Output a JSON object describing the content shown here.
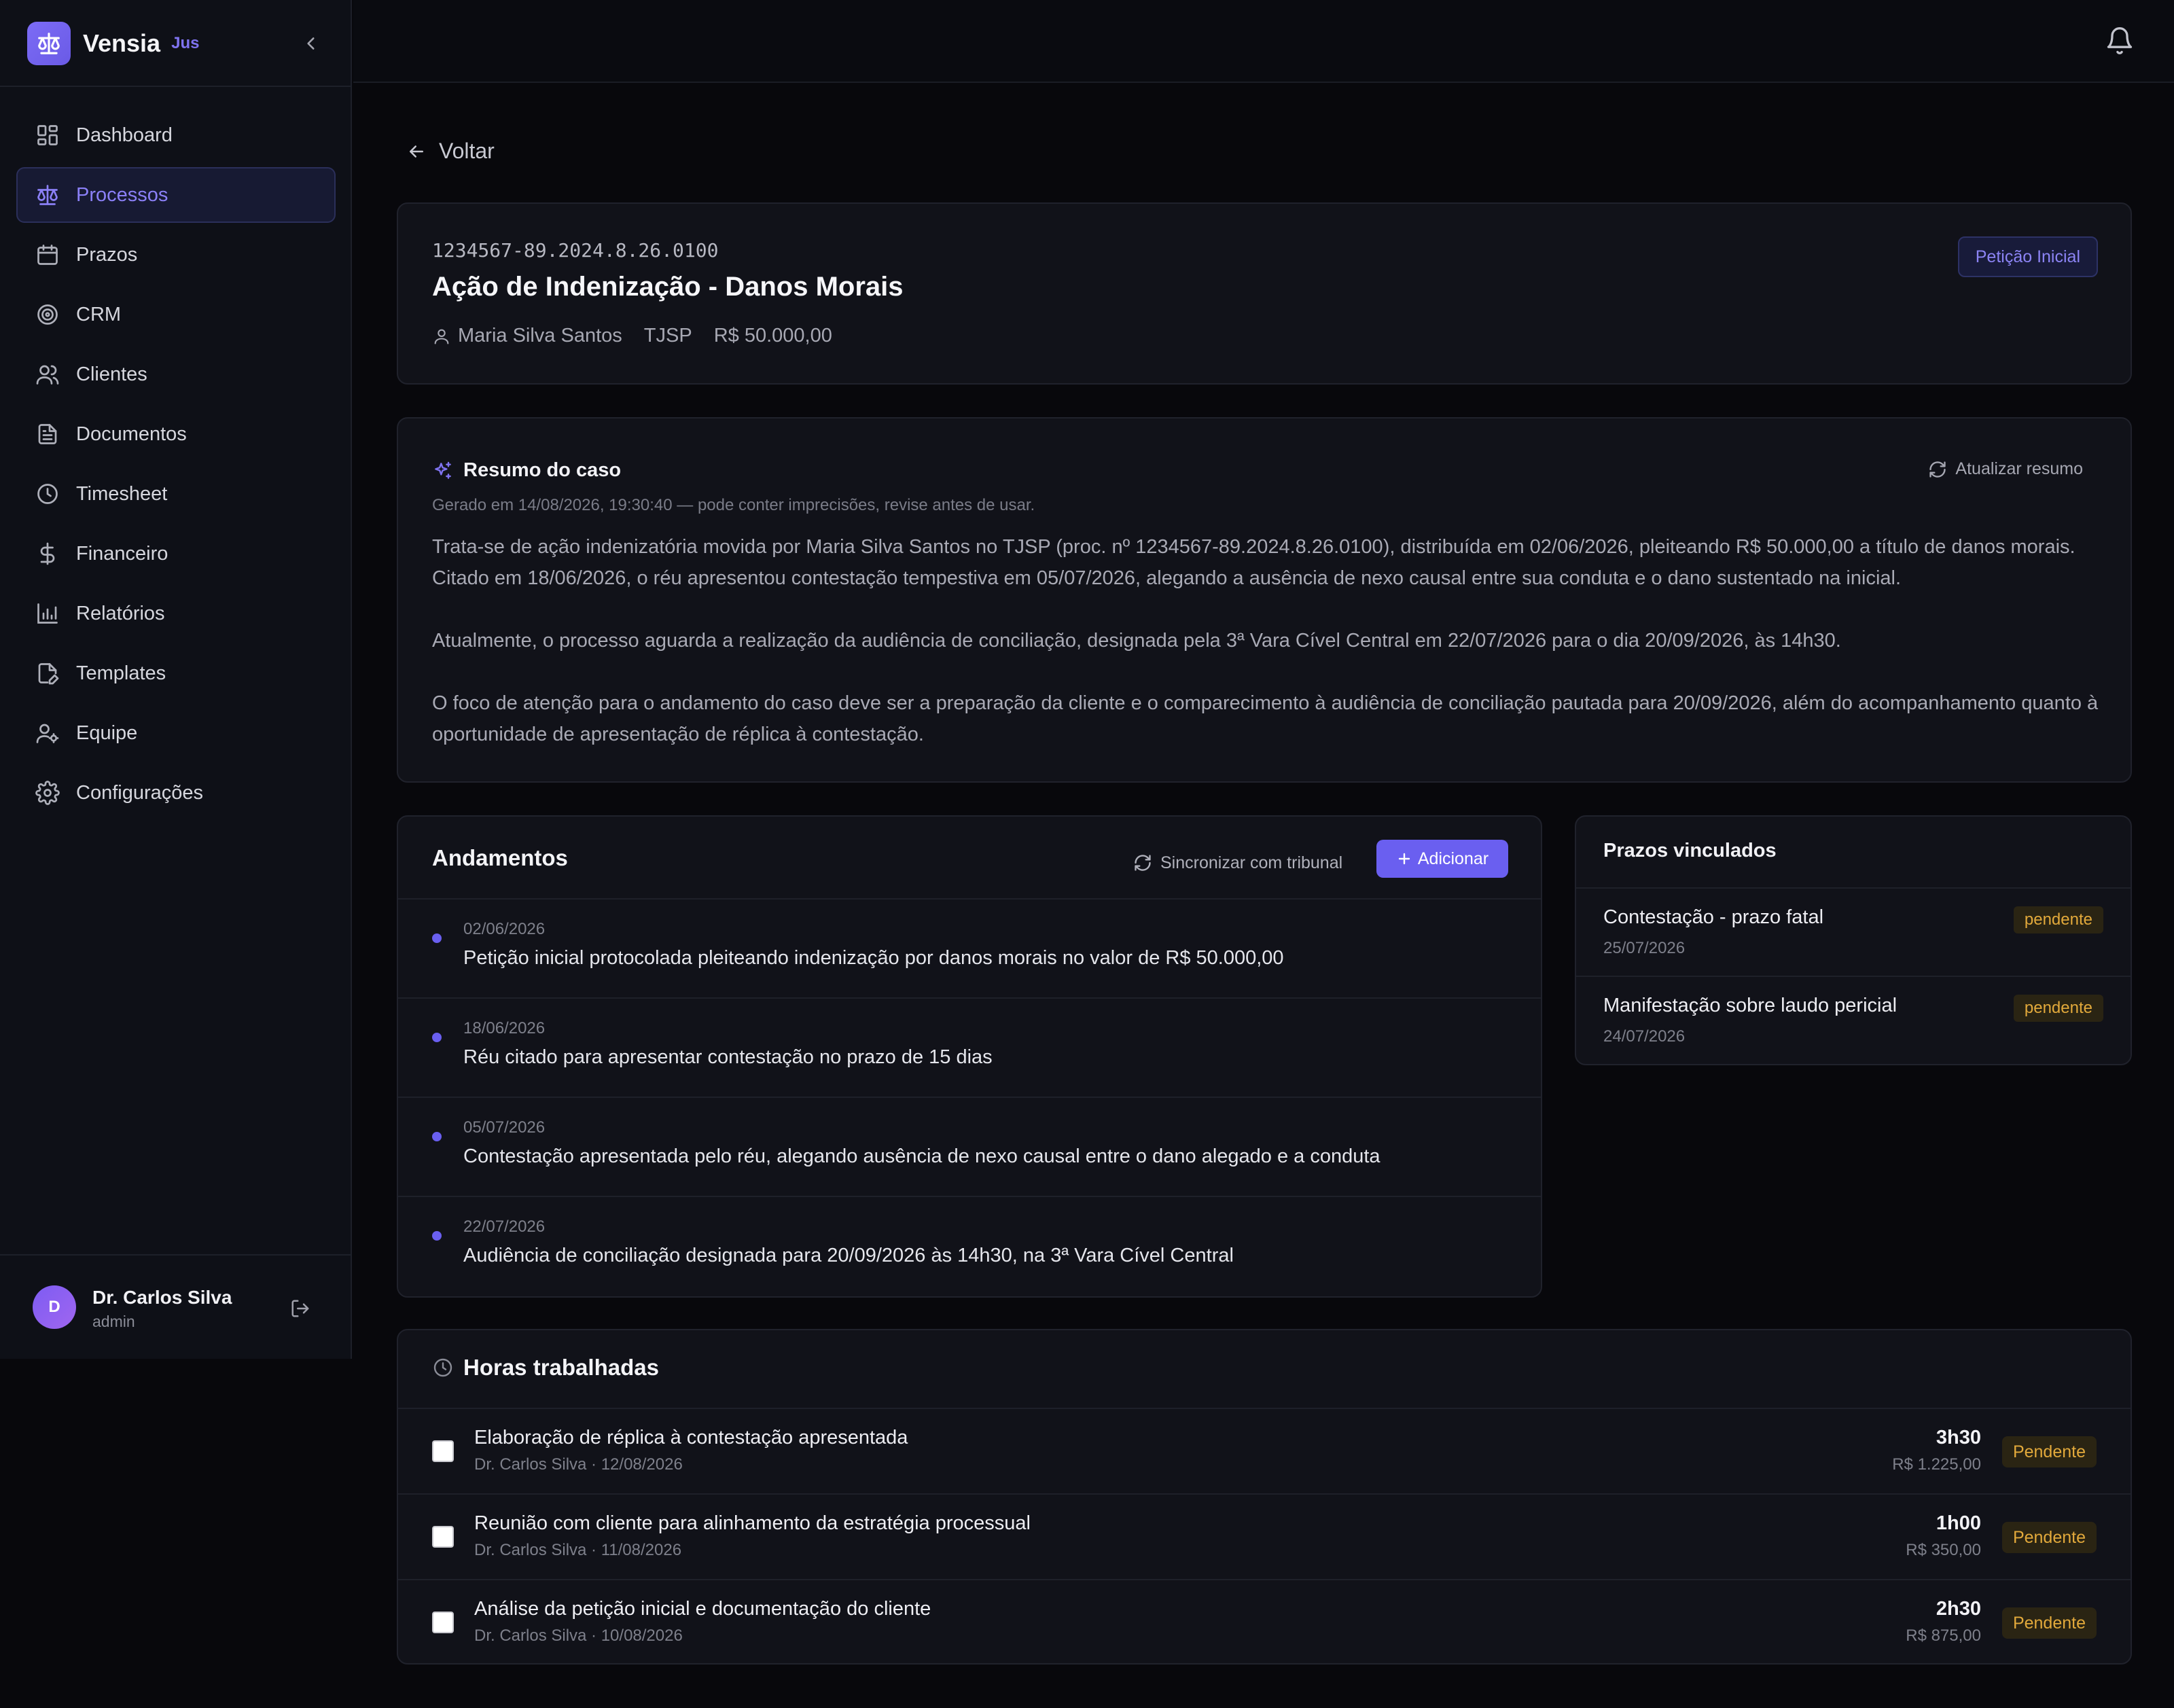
{
  "brand": {
    "name": "Vensia",
    "tag": "Jus",
    "accent": "#6a5ff0"
  },
  "sidebar": {
    "items": [
      {
        "label": "Dashboard",
        "icon": "dashboard-icon",
        "active": false
      },
      {
        "label": "Processos",
        "icon": "scale-icon",
        "active": true
      },
      {
        "label": "Prazos",
        "icon": "calendar-icon",
        "active": false
      },
      {
        "label": "CRM",
        "icon": "target-icon",
        "active": false
      },
      {
        "label": "Clientes",
        "icon": "users-icon",
        "active": false
      },
      {
        "label": "Documentos",
        "icon": "document-icon",
        "active": false
      },
      {
        "label": "Timesheet",
        "icon": "clock-icon",
        "active": false
      },
      {
        "label": "Financeiro",
        "icon": "dollar-icon",
        "active": false
      },
      {
        "label": "Relatórios",
        "icon": "bar-chart-icon",
        "active": false
      },
      {
        "label": "Templates",
        "icon": "edit-document-icon",
        "active": false
      },
      {
        "label": "Equipe",
        "icon": "user-cog-icon",
        "active": false
      },
      {
        "label": "Configurações",
        "icon": "gear-icon",
        "active": false
      }
    ]
  },
  "user": {
    "initial": "D",
    "name": "Dr. Carlos Silva",
    "role": "admin"
  },
  "nav": {
    "back_label": "Voltar"
  },
  "case": {
    "number": "1234567-89.2024.8.26.0100",
    "title": "Ação de Indenização - Danos Morais",
    "client": "Maria Silva Santos",
    "court": "TJSP",
    "amount": "R$ 50.000,00",
    "phase": "Petição Inicial"
  },
  "summary": {
    "title": "Resumo do caso",
    "refresh_label": "Atualizar resumo",
    "note": "Gerado em 14/08/2026, 19:30:40 — pode conter imprecisões, revise antes de usar.",
    "paragraphs": [
      "Trata-se de ação indenizatória movida por Maria Silva Santos no TJSP (proc. nº 1234567-89.2024.8.26.0100), distribuída em 02/06/2026, pleiteando R$ 50.000,00 a título de danos morais. Citado em 18/06/2026, o réu apresentou contestação tempestiva em 05/07/2026, alegando a ausência de nexo causal entre sua conduta e o dano sustentado na inicial.",
      "Atualmente, o processo aguarda a realização da audiência de conciliação, designada pela 3ª Vara Cível Central em 22/07/2026 para o dia 20/09/2026, às 14h30.",
      "O foco de atenção para o andamento do caso deve ser a preparação da cliente e o comparecimento à audiência de conciliação pautada para 20/09/2026, além do acompanhamento quanto à oportunidade de apresentação de réplica à contestação."
    ]
  },
  "andamentos": {
    "title": "Andamentos",
    "sync_label": "Sincronizar com tribunal",
    "add_label": "Adicionar",
    "items": [
      {
        "date": "02/06/2026",
        "text": "Petição inicial protocolada pleiteando indenização por danos morais no valor de R$ 50.000,00"
      },
      {
        "date": "18/06/2026",
        "text": "Réu citado para apresentar contestação no prazo de 15 dias"
      },
      {
        "date": "05/07/2026",
        "text": "Contestação apresentada pelo réu, alegando ausência de nexo causal entre o dano alegado e a conduta"
      },
      {
        "date": "22/07/2026",
        "text": "Audiência de conciliação designada para 20/09/2026 às 14h30, na 3ª Vara Cível Central"
      }
    ]
  },
  "prazos": {
    "title": "Prazos vinculados",
    "items": [
      {
        "name": "Contestação - prazo fatal",
        "date": "25/07/2026",
        "status": "pendente"
      },
      {
        "name": "Manifestação sobre laudo pericial",
        "date": "24/07/2026",
        "status": "pendente"
      }
    ]
  },
  "horas": {
    "title": "Horas trabalhadas",
    "items": [
      {
        "description": "Elaboração de réplica à contestação apresentada",
        "meta": "Dr. Carlos Silva · 12/08/2026",
        "duration": "3h30",
        "value": "R$ 1.225,00",
        "status": "Pendente",
        "checked": false
      },
      {
        "description": "Reunião com cliente para alinhamento da estratégia processual",
        "meta": "Dr. Carlos Silva · 11/08/2026",
        "duration": "1h00",
        "value": "R$ 350,00",
        "status": "Pendente",
        "checked": false
      },
      {
        "description": "Análise da petição inicial e documentação do cliente",
        "meta": "Dr. Carlos Silva · 10/08/2026",
        "duration": "2h30",
        "value": "R$ 875,00",
        "status": "Pendente",
        "checked": false
      }
    ]
  }
}
